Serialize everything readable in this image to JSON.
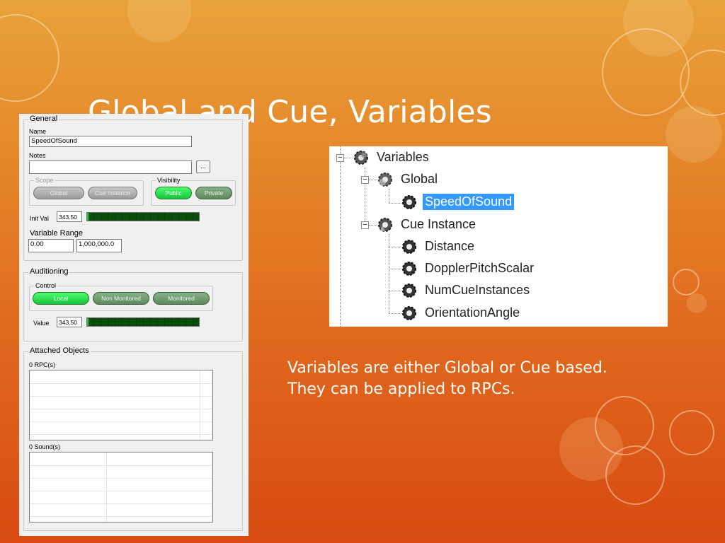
{
  "slide": {
    "title": "Global and Cue, Variables",
    "caption_lines": [
      "Variables are either Global or Cue based.",
      "They can be applied to RPCs."
    ]
  },
  "panel": {
    "general": {
      "legend": "General",
      "name_label": "Name",
      "name_value": "SpeedOfSound",
      "notes_label": "Notes",
      "notes_value": "",
      "browse_label": "...",
      "scope": {
        "legend": "Scope",
        "options": [
          "Global",
          "Cue Instance"
        ]
      },
      "visibility": {
        "legend": "Visibility",
        "options": [
          "Public",
          "Private"
        ],
        "selected": "Public"
      },
      "init_label": "Init Val",
      "init_value": "343.50",
      "init_meter_fraction": 0.01,
      "range_label": "Variable Range",
      "range_min": "0.00",
      "range_max": "1,000,000.0"
    },
    "auditioning": {
      "legend": "Auditioning",
      "control_legend": "Control",
      "modes": [
        "Local",
        "Non Monitored",
        "Monitored"
      ],
      "selected": "Local",
      "value_label": "Value",
      "value": "343.50",
      "value_meter_fraction": 0.01
    },
    "attached": {
      "legend": "Attached Objects",
      "rpc_label": "0 RPC(s)",
      "sound_label": "0 Sound(s)"
    }
  },
  "tree": {
    "root": {
      "label": "Variables",
      "icon": "variables-knob-icon"
    },
    "global": {
      "label": "Global",
      "icon": "global-knob-icon",
      "children": [
        "SpeedOfSound"
      ],
      "selected": "SpeedOfSound"
    },
    "cue": {
      "label": "Cue Instance",
      "icon": "cue-instance-knob-icon",
      "children": [
        "Distance",
        "DopplerPitchScalar",
        "NumCueInstances",
        "OrientationAngle"
      ]
    }
  },
  "colors": {
    "selection": "#3399ff",
    "active_green": "#1fd43b",
    "meter_bg": "#0a4a0a"
  }
}
